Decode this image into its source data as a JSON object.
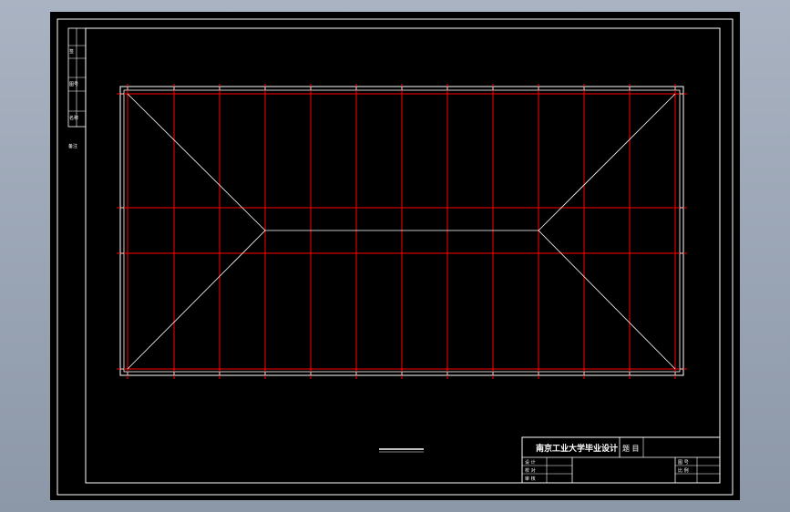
{
  "colors": {
    "background_gradient_top": "#a9b3c2",
    "background_gradient_bottom": "#8c97a8",
    "drawing_sheet": "#000000",
    "lines": "#ffffff",
    "grid": "#ff0000"
  },
  "title_block": {
    "school": "南京工业大学毕业设计",
    "figure_label": "题 目",
    "row1_left": "设 计",
    "row2_left": "校 对",
    "row3_left": "审 核",
    "right_row1": "图 号",
    "right_row2": "比 例"
  },
  "side_strip": {
    "label1": "签",
    "label2": "图号",
    "label3": "名称",
    "label4": "备注"
  }
}
